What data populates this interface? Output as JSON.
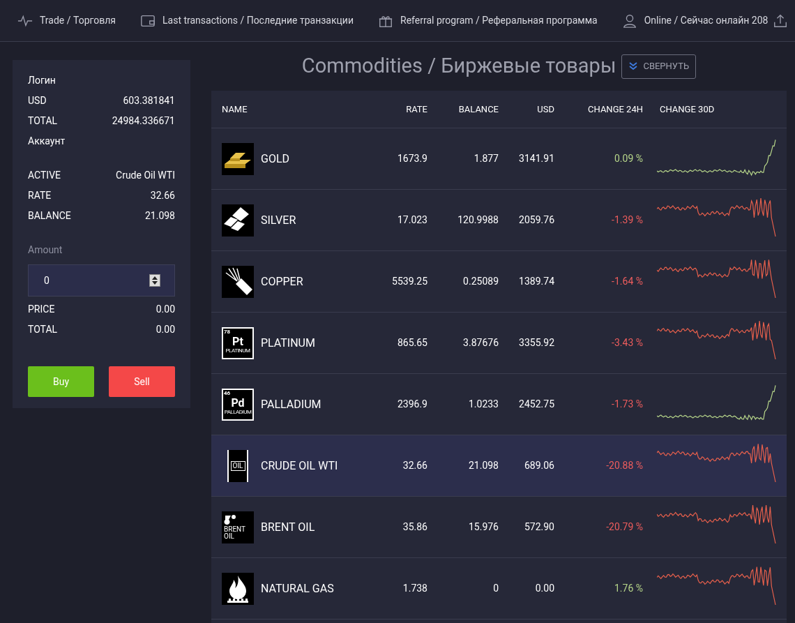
{
  "nav": [
    {
      "kind": "pulse",
      "label": "Trade / Торговля"
    },
    {
      "kind": "wallet",
      "label": "Last transactions / Последние транзакции"
    },
    {
      "kind": "gift",
      "label": "Referral program / Реферальная программа"
    },
    {
      "kind": "user",
      "label": "Online / Сейчас онлайн 208"
    }
  ],
  "account": {
    "title": "Логин",
    "rows": [
      {
        "label": "USD",
        "value": "603.381841"
      },
      {
        "label": "TOTAL",
        "value": "24984.336671"
      }
    ],
    "subtitle": "Аккаунт"
  },
  "asset": [
    {
      "label": "ACTIVE",
      "value": "Crude Oil WTI"
    },
    {
      "label": "RATE",
      "value": "32.66"
    },
    {
      "label": "BALANCE",
      "value": "21.098"
    }
  ],
  "order": {
    "amount_label": "Amount",
    "amount_value": "0",
    "rows": [
      {
        "label": "PRICE",
        "value": "0.00"
      },
      {
        "label": "TOTAL",
        "value": "0.00"
      }
    ],
    "buy": "Buy",
    "sell": "Sell"
  },
  "page_title": "Commodities / Биржевые товары",
  "collapse_button": "СВЕРНУТЬ",
  "table": {
    "columns": [
      "NAME",
      "RATE",
      "BALANCE",
      "USD",
      "CHANGE 24H",
      "CHANGE 30D"
    ],
    "rows": [
      {
        "icon": {
          "kind": "gold"
        },
        "name": "GOLD",
        "rate": "1673.9",
        "balance": "1.877",
        "usd": "3141.91",
        "change": "0.09 %",
        "positive": true,
        "sparkline_rising": true,
        "selected": false
      },
      {
        "icon": {
          "kind": "silver"
        },
        "name": "SILVER",
        "rate": "17.023",
        "balance": "120.9988",
        "usd": "2059.76",
        "change": "-1.39 %",
        "positive": false,
        "sparkline_rising": false,
        "selected": false
      },
      {
        "icon": {
          "kind": "copper"
        },
        "name": "COPPER",
        "rate": "5539.25",
        "balance": "0.25089",
        "usd": "1389.74",
        "change": "-1.64 %",
        "positive": false,
        "sparkline_rising": false,
        "selected": false
      },
      {
        "icon": {
          "kind": "element",
          "number": "78",
          "symbol": "Pt",
          "caption": "PLATINUM"
        },
        "name": "PLATINUM",
        "rate": "865.65",
        "balance": "3.87676",
        "usd": "3355.92",
        "change": "-3.43 %",
        "positive": false,
        "sparkline_rising": false,
        "selected": false
      },
      {
        "icon": {
          "kind": "element",
          "number": "46",
          "symbol": "Pd",
          "caption": "PALLADIUM"
        },
        "name": "PALLADIUM",
        "rate": "2396.9",
        "balance": "1.0233",
        "usd": "2452.75",
        "change": "-1.73 %",
        "positive": false,
        "sparkline_rising": true,
        "selected": false
      },
      {
        "icon": {
          "kind": "barrel",
          "caption": "OIL"
        },
        "name": "CRUDE OIL WTI",
        "rate": "32.66",
        "balance": "21.098",
        "usd": "689.06",
        "change": "-20.88 %",
        "positive": false,
        "sparkline_rising": false,
        "selected": true
      },
      {
        "icon": {
          "kind": "brent",
          "caption": [
            "BRENT",
            "OIL"
          ]
        },
        "name": "BRENT OIL",
        "rate": "35.86",
        "balance": "15.976",
        "usd": "572.90",
        "change": "-20.79 %",
        "positive": false,
        "sparkline_rising": false,
        "selected": false
      },
      {
        "icon": {
          "kind": "flame"
        },
        "name": "NATURAL GAS",
        "rate": "1.738",
        "balance": "0",
        "usd": "0.00",
        "change": "1.76 %",
        "positive": true,
        "sparkline_rising": false,
        "selected": false
      }
    ]
  }
}
